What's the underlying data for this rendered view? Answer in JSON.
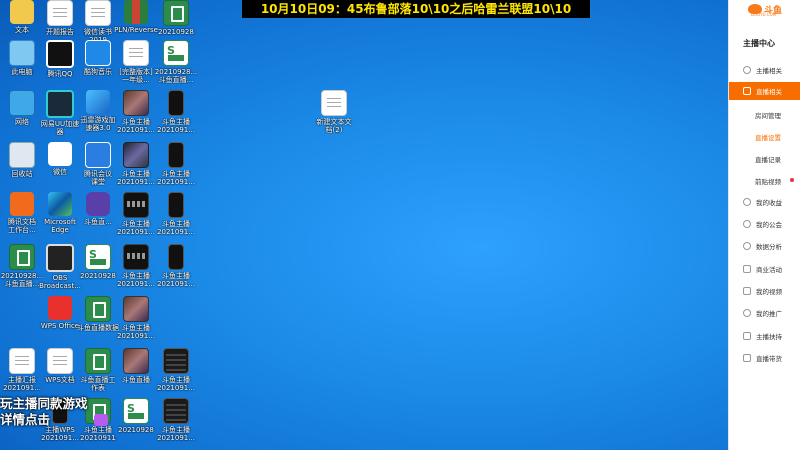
{
  "banner": {
    "text": "10月10日09：45布鲁部落10\\10之后哈雷兰联盟10\\10"
  },
  "overlay": {
    "line1": "玩主播同款游戏",
    "line2": "详情点击"
  },
  "panel": {
    "brand": "斗鱼",
    "brand_sub": "DOUYU.COM",
    "title": "主播中心",
    "items": [
      {
        "label": "主播相关",
        "icon": "microphone-icon"
      },
      {
        "label": "直播相关",
        "icon": "tv-icon",
        "active": true
      },
      {
        "label": "我的收益",
        "icon": "coin-icon"
      },
      {
        "label": "我的公会",
        "icon": "guild-icon"
      },
      {
        "label": "数据分析",
        "icon": "chart-icon"
      },
      {
        "label": "商业活动",
        "icon": "shop-icon"
      },
      {
        "label": "我的视频",
        "icon": "video-icon"
      },
      {
        "label": "我的推广",
        "icon": "promote-icon"
      },
      {
        "label": "主播扶持",
        "icon": "thumb-icon"
      },
      {
        "label": "直播带货",
        "icon": "bag-icon"
      }
    ],
    "subitems": [
      {
        "label": "房间管理"
      },
      {
        "label": "直播设置",
        "selected": true
      },
      {
        "label": "直播记录"
      },
      {
        "label": "前贴视频",
        "badge": "red-dot"
      }
    ]
  },
  "desktop": {
    "icons": [
      {
        "label": "文本",
        "icon": "folder-icon"
      },
      {
        "label": "开题报告",
        "icon": "document-icon"
      },
      {
        "label": "微信读书\n2019",
        "icon": "document-icon"
      },
      {
        "label": "PLN/Reverse",
        "icon": "app-icon"
      },
      {
        "label": "20210928",
        "icon": "spreadsheet-icon"
      },
      {
        "label": "此电脑",
        "icon": "computer-icon"
      },
      {
        "label": "腾讯QQ",
        "icon": "qq-icon"
      },
      {
        "label": "酷狗音乐",
        "icon": "kugou-icon"
      },
      {
        "label": "[完整版本]\n一年级...",
        "icon": "document-icon"
      },
      {
        "label": "20210928...\n斗鱼直播...",
        "icon": "spreadsheet-icon"
      },
      {
        "label": "网络",
        "icon": "network-icon"
      },
      {
        "label": "网易UU加速\n器",
        "icon": "uu-icon"
      },
      {
        "label": "迅雷游戏加\n速器3.0",
        "icon": "accelerator-icon"
      },
      {
        "label": "斗鱼主播\n2021091...",
        "icon": "photo-icon"
      },
      {
        "label": "斗鱼主播\n2021091...",
        "icon": "phone-icon"
      },
      {
        "label": "回收站",
        "icon": "recycle-bin-icon"
      },
      {
        "label": "微信",
        "icon": "wechat-icon"
      },
      {
        "label": "腾讯会议\n课堂",
        "icon": "meeting-icon"
      },
      {
        "label": "斗鱼主播\n2021091...",
        "icon": "photo-icon"
      },
      {
        "label": "斗鱼主播\n2021091...",
        "icon": "phone-icon"
      },
      {
        "label": "腾讯文档\n工作台...",
        "icon": "app-icon"
      },
      {
        "label": "Microsoft\nEdge",
        "icon": "edge-icon"
      },
      {
        "label": "斗鱼直...",
        "icon": "w-icon"
      },
      {
        "label": "斗鱼主播\n2021091...",
        "icon": "strip-icon"
      },
      {
        "label": "斗鱼主播\n2021091...",
        "icon": "phone-icon"
      },
      {
        "label": "20210928...\n斗鱼直播...",
        "icon": "spreadsheet-icon"
      },
      {
        "label": "OBS\nBroadcast...",
        "icon": "obs-icon"
      },
      {
        "label": "20210928",
        "icon": "spreadsheet-icon"
      },
      {
        "label": "斗鱼主播\n2021091...",
        "icon": "strip-icon"
      },
      {
        "label": "斗鱼主播\n2021091...",
        "icon": "phone-icon"
      },
      {
        "label": "WPS Office",
        "icon": "wps-icon"
      },
      {
        "label": "斗鱼直播数据",
        "icon": "spreadsheet-icon"
      },
      {
        "label": "斗鱼主播\n2021091...",
        "icon": "photo-icon"
      },
      {
        "label": "主播汇报\n2021091...",
        "icon": "document-icon"
      },
      {
        "label": "WPS文档",
        "icon": "document-icon"
      },
      {
        "label": "斗鱼直播工\n作表",
        "icon": "spreadsheet-icon"
      },
      {
        "label": "斗鱼直播",
        "icon": "photo-icon"
      },
      {
        "label": "斗鱼主播\n2021091...",
        "icon": "rack-icon"
      },
      {
        "label": "主播WPS\n2021091...",
        "icon": "phone-icon"
      },
      {
        "label": "斗鱼主播\n20210911",
        "icon": "spreadsheet-icon"
      },
      {
        "label": "20210928",
        "icon": "spreadsheet-icon"
      },
      {
        "label": "斗鱼主播\n2021091...",
        "icon": "rack-icon"
      },
      {
        "label": "新建文本文\n档(2)",
        "icon": "document-icon"
      }
    ]
  }
}
